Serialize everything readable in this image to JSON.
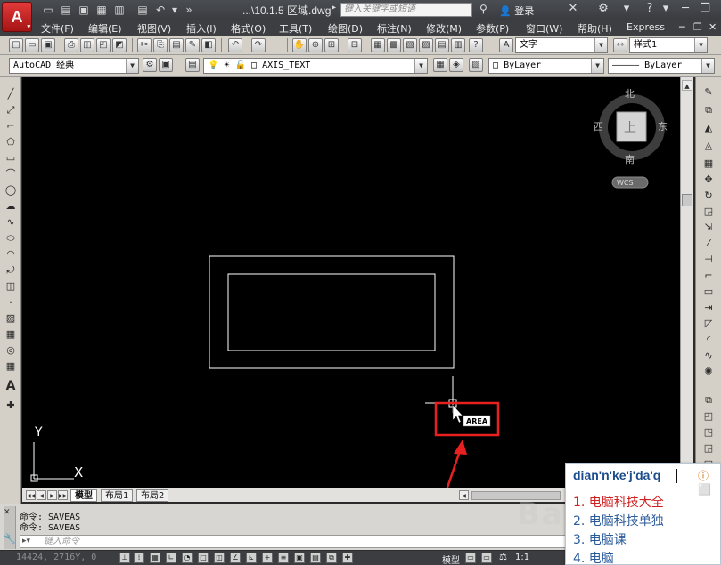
{
  "titlebar": {
    "app_logo": "A",
    "doc_title": "...\\10.1.5 区域.dwg",
    "search_placeholder": "键入关键字或短语",
    "login_label": "登录"
  },
  "menu": {
    "items": [
      "文件(F)",
      "编辑(E)",
      "视图(V)",
      "插入(I)",
      "格式(O)",
      "工具(T)",
      "绘图(D)",
      "标注(N)",
      "修改(M)",
      "参数(P)",
      "窗口(W)",
      "帮助(H)",
      "Express"
    ]
  },
  "toolbar": {
    "text_style_label": "文字",
    "dim_style_label": "样式1",
    "workspace": "AutoCAD 经典",
    "layer": "AXIS_TEXT",
    "color": "ByLayer",
    "linetype": "ByLayer"
  },
  "viewcube": {
    "north": "北",
    "south": "南",
    "east": "东",
    "west": "西",
    "top_face": "上",
    "wcs_label": "WCS"
  },
  "ucs": {
    "x_label": "X",
    "y_label": "Y"
  },
  "canvas": {
    "tooltip": "AREA",
    "colors": {
      "highlight": "#e82020",
      "stroke": "#ffffff",
      "background": "#000000"
    }
  },
  "tabs": [
    "模型",
    "布局1",
    "布局2"
  ],
  "command": {
    "history": [
      "命令:  SAVEAS",
      "命令:  SAVEAS"
    ],
    "input_placeholder": "键入命令"
  },
  "statusbar": {
    "coords": "14424, 2716Y, 0",
    "model_label": "模型",
    "scale": "1:1"
  },
  "ime": {
    "composition": "dian'n'ke'j'da'q",
    "candidates": [
      "1. 电脑科技大全",
      "2. 电脑科技单独",
      "3. 电脑课",
      "4. 电脑"
    ]
  },
  "watermark": "Bai du"
}
